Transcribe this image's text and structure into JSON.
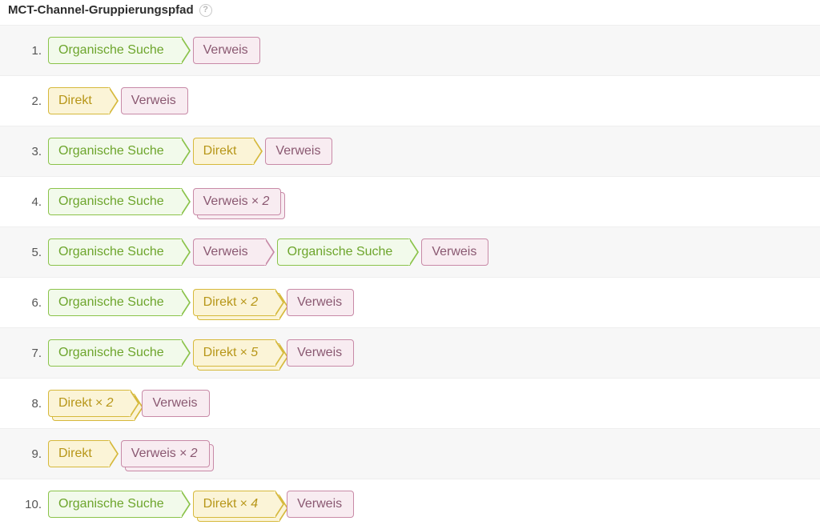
{
  "header": {
    "title": "MCT-Channel-Gruppierungspfad",
    "help_symbol": "?"
  },
  "channel_labels": {
    "organic": "Organische Suche",
    "direct": "Direkt",
    "referral": "Verweis"
  },
  "rows": [
    {
      "num": "1.",
      "path": [
        {
          "t": "organic",
          "arrow": true
        },
        {
          "t": "referral"
        }
      ]
    },
    {
      "num": "2.",
      "path": [
        {
          "t": "direct",
          "arrow": true
        },
        {
          "t": "referral"
        }
      ]
    },
    {
      "num": "3.",
      "path": [
        {
          "t": "organic",
          "arrow": true
        },
        {
          "t": "direct",
          "arrow": true
        },
        {
          "t": "referral"
        }
      ]
    },
    {
      "num": "4.",
      "path": [
        {
          "t": "organic",
          "arrow": true
        },
        {
          "t": "referral",
          "count": 2
        }
      ]
    },
    {
      "num": "5.",
      "path": [
        {
          "t": "organic",
          "arrow": true
        },
        {
          "t": "referral",
          "arrow": true
        },
        {
          "t": "organic",
          "arrow": true
        },
        {
          "t": "referral"
        }
      ]
    },
    {
      "num": "6.",
      "path": [
        {
          "t": "organic",
          "arrow": true
        },
        {
          "t": "direct",
          "arrow": true,
          "count": 2
        },
        {
          "t": "referral"
        }
      ]
    },
    {
      "num": "7.",
      "path": [
        {
          "t": "organic",
          "arrow": true
        },
        {
          "t": "direct",
          "arrow": true,
          "count": 5
        },
        {
          "t": "referral"
        }
      ]
    },
    {
      "num": "8.",
      "path": [
        {
          "t": "direct",
          "arrow": true,
          "count": 2
        },
        {
          "t": "referral"
        }
      ]
    },
    {
      "num": "9.",
      "path": [
        {
          "t": "direct",
          "arrow": true
        },
        {
          "t": "referral",
          "count": 2
        }
      ]
    },
    {
      "num": "10.",
      "path": [
        {
          "t": "organic",
          "arrow": true
        },
        {
          "t": "direct",
          "arrow": true,
          "count": 4
        },
        {
          "t": "referral"
        }
      ]
    }
  ]
}
